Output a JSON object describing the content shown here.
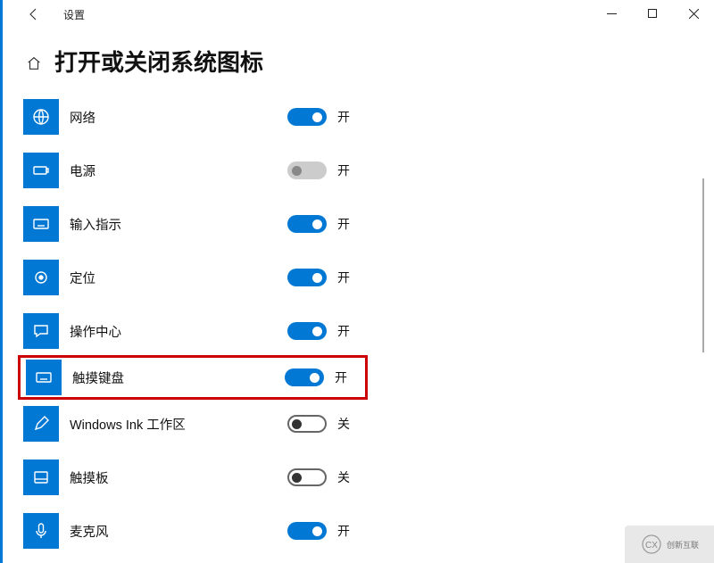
{
  "app": {
    "title": "设置"
  },
  "page": {
    "title": "打开或关闭系统图标"
  },
  "toggleText": {
    "on": "开",
    "off": "关"
  },
  "items": [
    {
      "id": "network",
      "label": "网络",
      "icon": "globe",
      "state": "on"
    },
    {
      "id": "power",
      "label": "电源",
      "icon": "battery",
      "state": "disabled"
    },
    {
      "id": "ime",
      "label": "输入指示",
      "icon": "keyboard",
      "state": "on"
    },
    {
      "id": "location",
      "label": "定位",
      "icon": "target",
      "state": "on"
    },
    {
      "id": "action",
      "label": "操作中心",
      "icon": "message",
      "state": "on"
    },
    {
      "id": "touchkb",
      "label": "触摸键盘",
      "icon": "keyboard",
      "state": "on",
      "highlight": true
    },
    {
      "id": "ink",
      "label": "Windows Ink 工作区",
      "icon": "pen",
      "state": "off"
    },
    {
      "id": "touchpad",
      "label": "触摸板",
      "icon": "touchpad",
      "state": "off"
    },
    {
      "id": "mic",
      "label": "麦克风",
      "icon": "mic",
      "state": "on"
    }
  ],
  "watermark": "创新互联"
}
